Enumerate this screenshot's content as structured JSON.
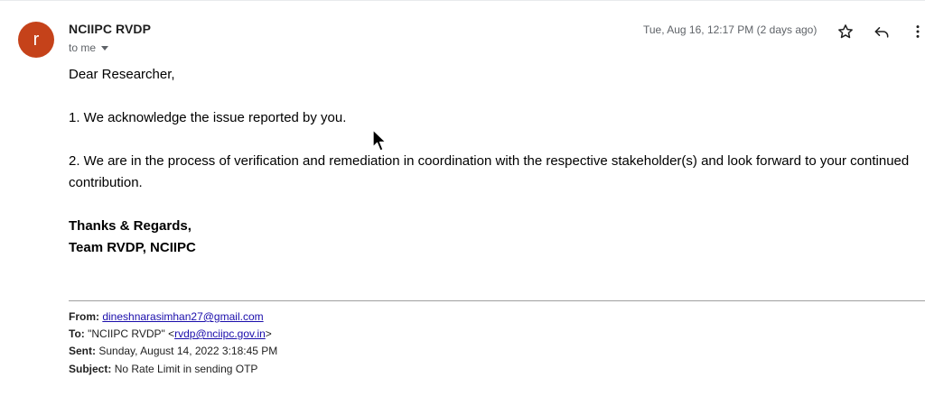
{
  "header": {
    "avatar_letter": "r",
    "avatar_color": "#c5421a",
    "sender_name": "NCIIPC RVDP",
    "recipient_label": "to me",
    "date": "Tue, Aug 16, 12:17 PM (2 days ago)",
    "icons": [
      "star-icon",
      "reply-icon",
      "more-vert-icon"
    ]
  },
  "body": {
    "greeting": "Dear Researcher,",
    "line1": "1. We acknowledge the issue reported by you.",
    "line2": "2. We are in the process of verification and remediation in coordination with the respective stakeholder(s) and look forward to your continued contribution.",
    "signoff": "Thanks & Regards,",
    "team": "Team RVDP, NCIIPC"
  },
  "quoted": {
    "from_label": "From:",
    "from_value": "dineshnarasimhan27@gmail.com",
    "to_label": "To:",
    "to_name": "\"NCIIPC RVDP\" <",
    "to_email": "rvdp@nciipc.gov.in",
    "to_suffix": ">",
    "sent_label": "Sent:",
    "sent_value": "Sunday, August 14, 2022 3:18:45 PM",
    "subject_label": "Subject:",
    "subject_value": "No Rate Limit in sending OTP"
  }
}
